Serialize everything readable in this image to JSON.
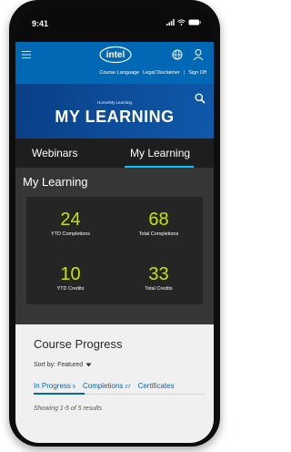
{
  "status_bar": {
    "time": "9:41"
  },
  "header": {
    "logo_text": "intel",
    "utility_links": [
      "Course Language",
      "Legal Disclaimer",
      "|",
      "Sign Off"
    ]
  },
  "banner": {
    "breadcrumb": "Home/My Learning",
    "title": "MY LEARNING"
  },
  "tabs": [
    {
      "label": "Webinars",
      "active": false
    },
    {
      "label": "My Learning",
      "active": true
    }
  ],
  "stats": {
    "title": "My Learning",
    "items": [
      {
        "value": "24",
        "label": "YTD Completions"
      },
      {
        "value": "68",
        "label": "Total Completions"
      },
      {
        "value": "10",
        "label": "YTD Credits"
      },
      {
        "value": "33",
        "label": "Total Credits"
      }
    ]
  },
  "course_progress": {
    "title": "Course Progress",
    "sort_label": "Sort by: Featured",
    "tabs": [
      {
        "label": "In Progress",
        "count": "5"
      },
      {
        "label": "Completions",
        "count": "27"
      },
      {
        "label": "Certificates",
        "count": ""
      }
    ],
    "results_text": "Showing 1-5 of 5 results"
  },
  "colors": {
    "intel_blue": "#0068b5",
    "accent_cyan": "#00c7fd",
    "stat_green": "#c4e400"
  }
}
